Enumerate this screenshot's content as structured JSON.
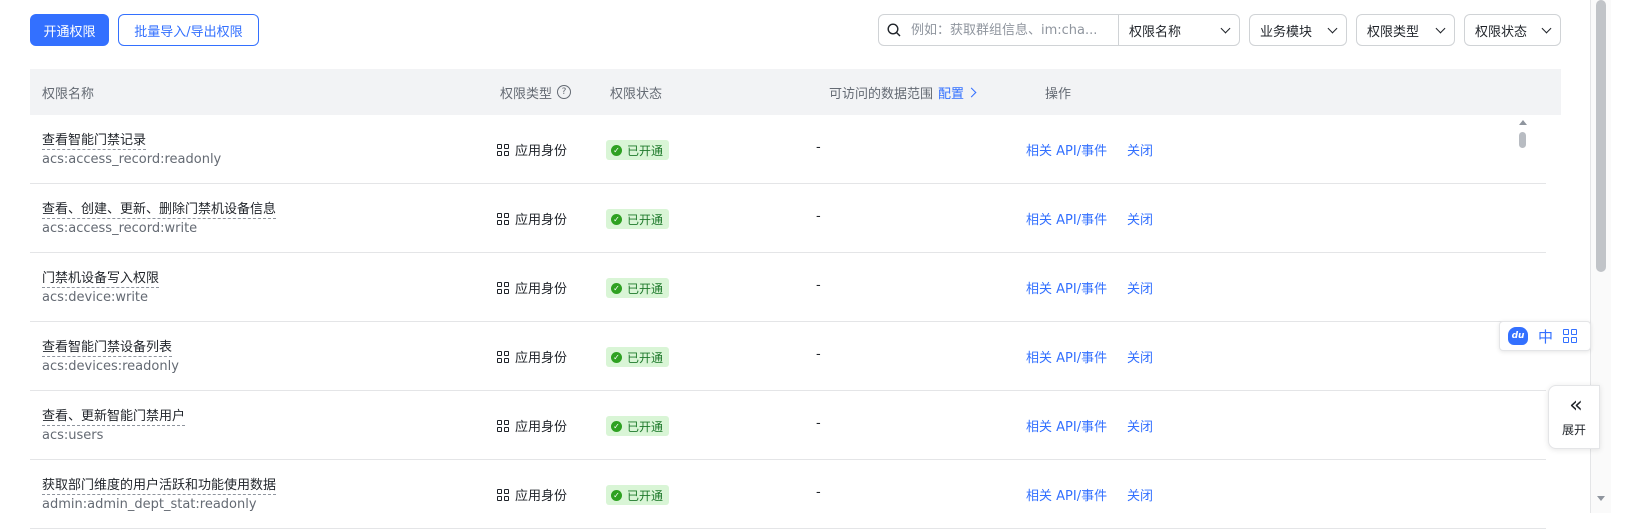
{
  "toolbar": {
    "open_btn": "开通权限",
    "import_btn": "批量导入/导出权限",
    "search_placeholder": "例如：获取群组信息、im:cha...",
    "search_field": "权限名称",
    "filters": [
      "业务模块",
      "权限类型",
      "权限状态"
    ]
  },
  "table": {
    "headers": {
      "name": "权限名称",
      "type": "权限类型",
      "status": "权限状态",
      "range": "可访问的数据范围",
      "range_config": "配置",
      "ops": "操作"
    },
    "rows": [
      {
        "name": "查看智能门禁记录",
        "code": "acs:access_record:readonly",
        "type": "应用身份",
        "status": "已开通",
        "range": "-",
        "action1": "相关 API/事件",
        "action2": "关闭"
      },
      {
        "name": "查看、创建、更新、删除门禁机设备信息",
        "code": "acs:access_record:write",
        "type": "应用身份",
        "status": "已开通",
        "range": "-",
        "action1": "相关 API/事件",
        "action2": "关闭"
      },
      {
        "name": "门禁机设备写入权限",
        "code": "acs:device:write",
        "type": "应用身份",
        "status": "已开通",
        "range": "-",
        "action1": "相关 API/事件",
        "action2": "关闭"
      },
      {
        "name": "查看智能门禁设备列表",
        "code": "acs:devices:readonly",
        "type": "应用身份",
        "status": "已开通",
        "range": "-",
        "action1": "相关 API/事件",
        "action2": "关闭"
      },
      {
        "name": "查看、更新智能门禁用户",
        "code": "acs:users",
        "type": "应用身份",
        "status": "已开通",
        "range": "-",
        "action1": "相关 API/事件",
        "action2": "关闭"
      },
      {
        "name": "获取部门维度的用户活跃和功能使用数据",
        "code": "admin:admin_dept_stat:readonly",
        "type": "应用身份",
        "status": "已开通",
        "range": "-",
        "action1": "相关 API/事件",
        "action2": "关闭"
      }
    ]
  },
  "float_tool": {
    "lang": "中",
    "du_text": "du"
  },
  "expand": {
    "label": "展开"
  }
}
